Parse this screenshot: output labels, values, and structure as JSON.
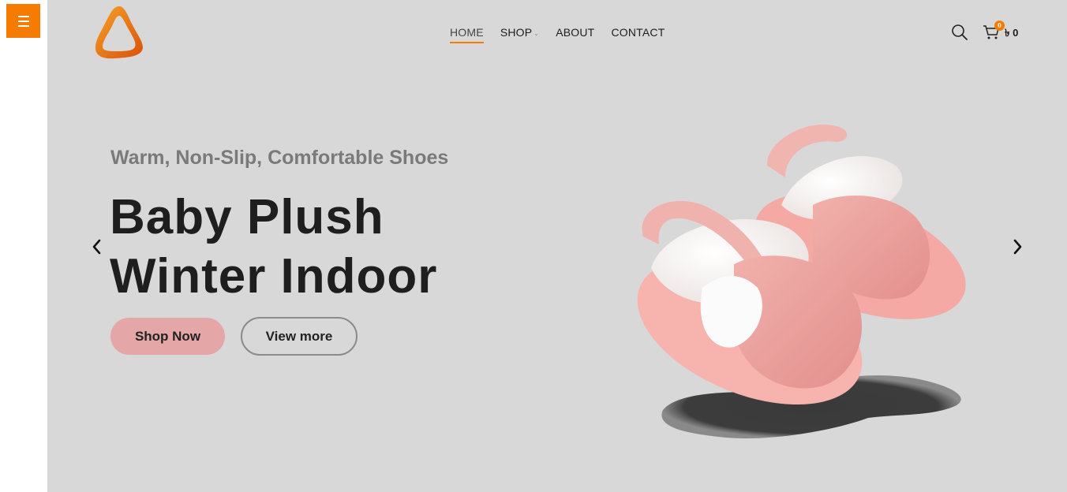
{
  "nav": {
    "items": [
      {
        "label": "HOME",
        "active": true
      },
      {
        "label": "SHOP",
        "dropdown": true
      },
      {
        "label": "ABOUT"
      },
      {
        "label": "CONTACT"
      }
    ]
  },
  "header": {
    "cart_count": "0",
    "cart_total": "৳ 0"
  },
  "hero": {
    "subtitle": "Warm, Non-Slip, Comfortable Shoes",
    "title_line1": "Baby Plush",
    "title_line2": "Winter Indoor",
    "primary_button": "Shop Now",
    "secondary_button": "View more",
    "primary_button_color": "#e4a6a6"
  },
  "colors": {
    "accent": "#f57c00",
    "hero_background": "#d8d8d8",
    "text_dark": "#1e1e1e",
    "text_muted": "#7a7a7a"
  },
  "icons": [
    "hamburger-menu-icon",
    "logo-icon",
    "search-icon",
    "cart-icon",
    "chevron-left-icon",
    "chevron-right-icon",
    "chevron-down-icon"
  ]
}
